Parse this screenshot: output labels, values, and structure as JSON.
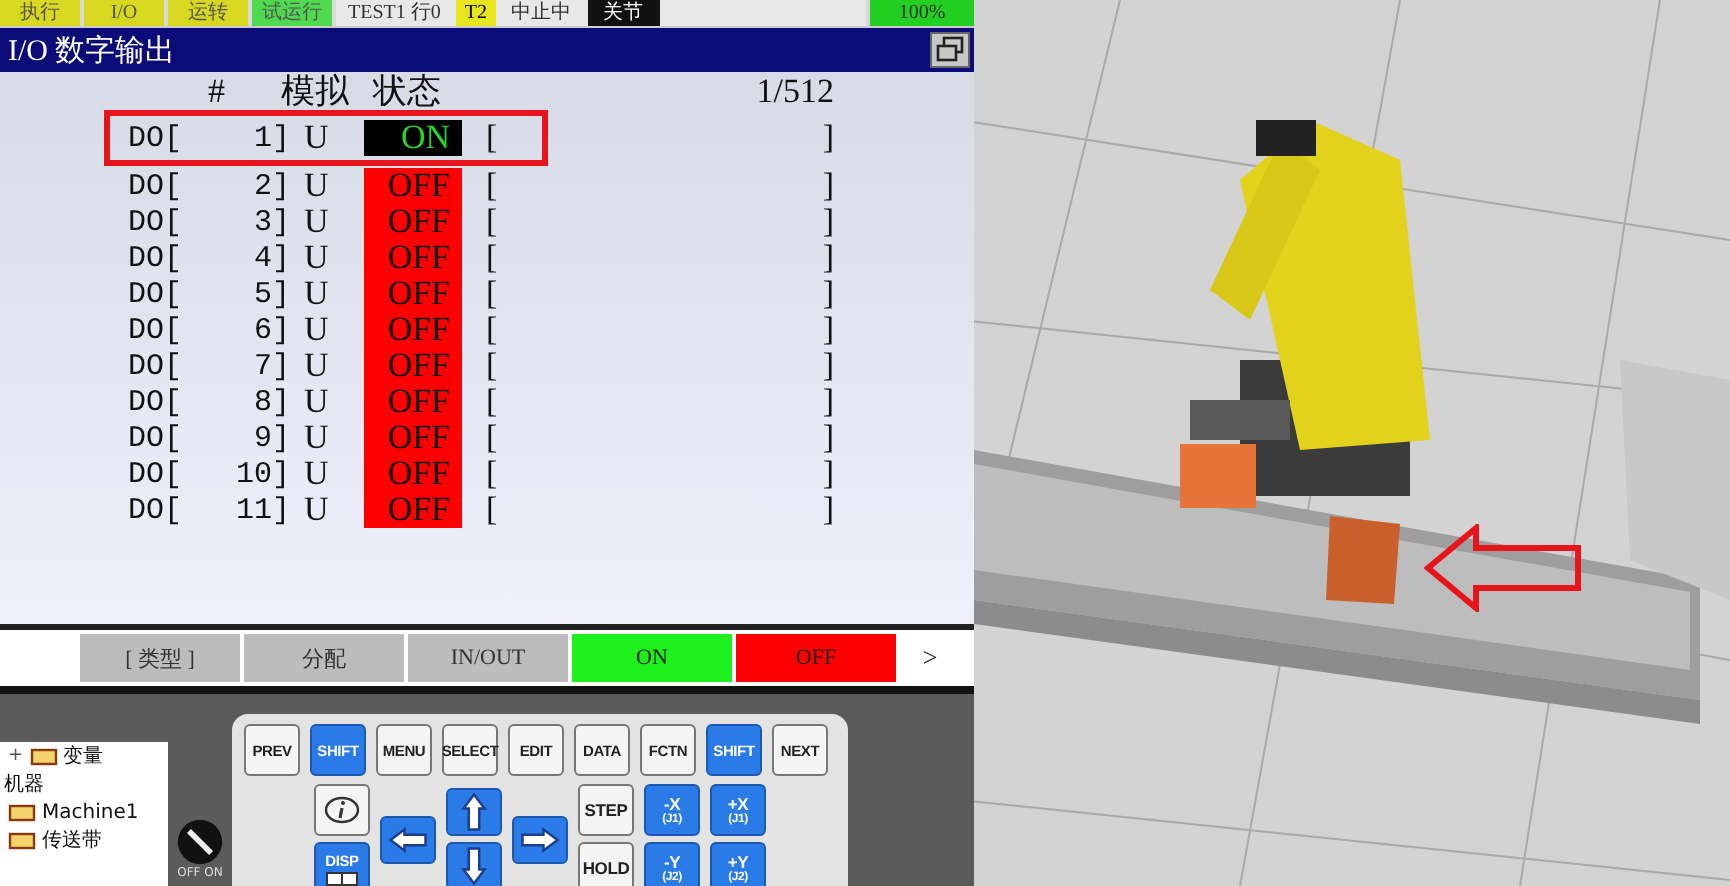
{
  "status_bar": [
    {
      "label": "执行",
      "kind": "yellow"
    },
    {
      "label": "I/O",
      "kind": "io"
    },
    {
      "label": "运转",
      "kind": "yellow"
    },
    {
      "label": "试运行",
      "kind": "green"
    }
  ],
  "program": {
    "name": "TEST1 行0",
    "mode": "T2",
    "state": "中止中",
    "coord": "关节",
    "speed": "100%"
  },
  "window": {
    "title": "I/O 数字输出"
  },
  "table": {
    "columns": [
      "#",
      "模拟",
      "状态"
    ],
    "page": "1/512",
    "rows": [
      {
        "label": "DO[    1]",
        "sim": "U",
        "state": "ON",
        "on": true,
        "open": "[",
        "close": "]"
      },
      {
        "label": "DO[    2]",
        "sim": "U",
        "state": "OFF",
        "on": false,
        "open": "[",
        "close": "]"
      },
      {
        "label": "DO[    3]",
        "sim": "U",
        "state": "OFF",
        "on": false,
        "open": "[",
        "close": "]"
      },
      {
        "label": "DO[    4]",
        "sim": "U",
        "state": "OFF",
        "on": false,
        "open": "[",
        "close": "]"
      },
      {
        "label": "DO[    5]",
        "sim": "U",
        "state": "OFF",
        "on": false,
        "open": "[",
        "close": "]"
      },
      {
        "label": "DO[    6]",
        "sim": "U",
        "state": "OFF",
        "on": false,
        "open": "[",
        "close": "]"
      },
      {
        "label": "DO[    7]",
        "sim": "U",
        "state": "OFF",
        "on": false,
        "open": "[",
        "close": "]"
      },
      {
        "label": "DO[    8]",
        "sim": "U",
        "state": "OFF",
        "on": false,
        "open": "[",
        "close": "]"
      },
      {
        "label": "DO[    9]",
        "sim": "U",
        "state": "OFF",
        "on": false,
        "open": "[",
        "close": "]"
      },
      {
        "label": "DO[   10]",
        "sim": "U",
        "state": "OFF",
        "on": false,
        "open": "[",
        "close": "]"
      },
      {
        "label": "DO[   11]",
        "sim": "U",
        "state": "OFF",
        "on": false,
        "open": "[",
        "close": "]"
      }
    ]
  },
  "function_keys": [
    {
      "label": "[ 类型 ]",
      "kind": "grey"
    },
    {
      "label": "分配",
      "kind": "grey"
    },
    {
      "label": "IN/OUT",
      "kind": "grey"
    },
    {
      "label": "ON",
      "kind": "green"
    },
    {
      "label": "OFF",
      "kind": "red"
    },
    {
      "label": ">",
      "kind": "next"
    }
  ],
  "tree": [
    {
      "label": "变量",
      "kind": "item",
      "expander": "+"
    },
    {
      "label": "机器",
      "kind": "header"
    },
    {
      "label": "Machine1",
      "kind": "item"
    },
    {
      "label": "传送带",
      "kind": "item"
    }
  ],
  "knob": {
    "label": "OFF ON"
  },
  "keypad": {
    "top_row": [
      {
        "label": "PREV",
        "kind": "plain"
      },
      {
        "label": "SHIFT",
        "kind": "blue"
      },
      {
        "label": "MENU",
        "kind": "plain"
      },
      {
        "label": "SELECT",
        "kind": "plain"
      },
      {
        "label": "EDIT",
        "kind": "plain"
      },
      {
        "label": "DATA",
        "kind": "plain"
      },
      {
        "label": "FCTN",
        "kind": "plain"
      },
      {
        "label": "SHIFT",
        "kind": "blue"
      },
      {
        "label": "NEXT",
        "kind": "plain"
      }
    ],
    "columns": [
      [
        {
          "kind": "info"
        },
        {
          "label": "DISP",
          "kind": "disp"
        }
      ],
      [
        {
          "kind": "arrow-left"
        }
      ],
      [
        {
          "kind": "arrow-up"
        },
        {
          "kind": "arrow-down"
        }
      ],
      [
        {
          "kind": "arrow-right"
        }
      ],
      [
        {
          "label": "STEP",
          "kind": "plain"
        },
        {
          "label": "HOLD",
          "kind": "plain"
        }
      ],
      [
        {
          "label": "-X",
          "sub": "(J1)",
          "kind": "blue"
        },
        {
          "label": "-Y",
          "sub": "(J2)",
          "kind": "blue"
        }
      ],
      [
        {
          "label": "+X",
          "sub": "(J1)",
          "kind": "blue"
        },
        {
          "label": "+Y",
          "sub": "(J2)",
          "kind": "blue"
        }
      ]
    ]
  }
}
